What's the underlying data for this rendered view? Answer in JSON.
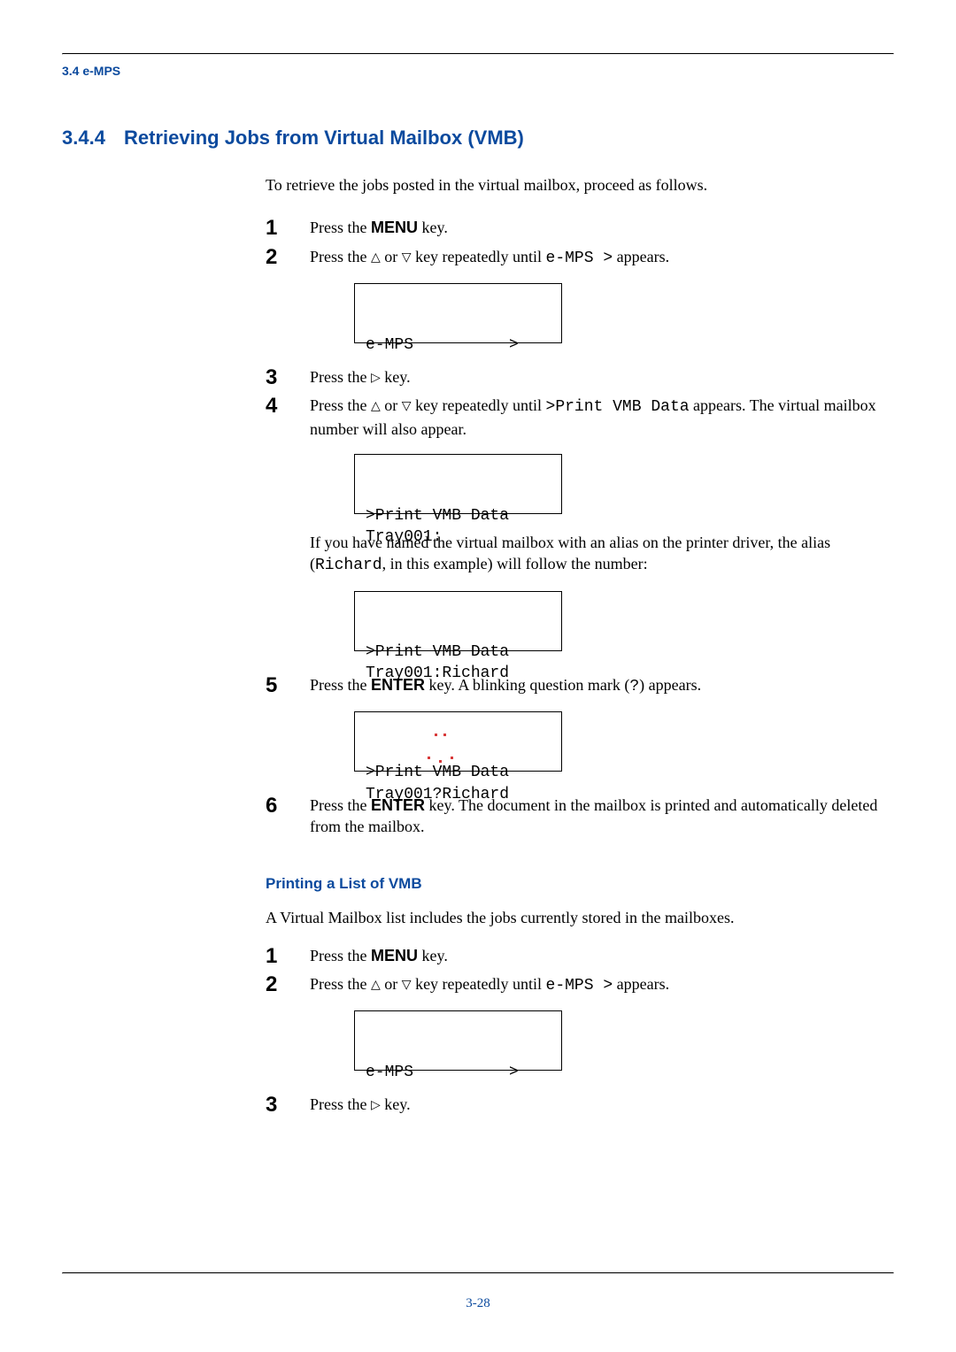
{
  "running_head": "3.4 e-MPS",
  "heading": {
    "num": "3.4.4",
    "title": "Retrieving Jobs from Virtual Mailbox (VMB)"
  },
  "intro": "To retrieve the jobs posted in the virtual mailbox, proceed as follows.",
  "glyphs": {
    "up": "△",
    "down": "▽",
    "right": "▷"
  },
  "stepsA": {
    "s1": {
      "num": "1",
      "pre": "Press the ",
      "key": "MENU",
      "post": " key."
    },
    "s2": {
      "num": "2",
      "pre": "Press the ",
      "mid": " key repeatedly until ",
      "code": "e-MPS >",
      "post": " appears."
    },
    "d2": {
      "line1": "e-MPS          >",
      "line2": ""
    },
    "s3": {
      "num": "3",
      "pre": "Press the ",
      "post": " key."
    },
    "s4": {
      "num": "4",
      "pre": "Press the ",
      "mid": " key repeatedly until ",
      "code": ">Print VMB Data",
      "post": " appears. The virtual mailbox number will also appear."
    },
    "d4": {
      "line1": ">Print VMB Data",
      "line2": "Tray001:"
    },
    "note4": {
      "pre": "If you have named the virtual mailbox with an alias on the printer driver, the alias (",
      "code": "Richard",
      "post": ", in this example) will follow the number:"
    },
    "d4b": {
      "line1": ">Print VMB Data",
      "line2": "Tray001:Richard"
    },
    "s5": {
      "num": "5",
      "pre": "Press the ",
      "key": "ENTER",
      "mid": " key. A blinking question mark (",
      "code": "?",
      "post": ") appears."
    },
    "d5": {
      "line1": ">Print VMB Data",
      "line2": "Tray001?Richard"
    },
    "s6": {
      "num": "6",
      "pre": "Press the ",
      "key": "ENTER",
      "post": " key. The document in the mailbox is printed and automatically deleted from the mailbox."
    }
  },
  "sub": {
    "title": "Printing a List of VMB",
    "intro": "A Virtual Mailbox list includes the jobs currently stored in the mailboxes.",
    "s1": {
      "num": "1",
      "pre": "Press the ",
      "key": "MENU",
      "post": " key."
    },
    "s2": {
      "num": "2",
      "pre": "Press the ",
      "mid": " key repeatedly until ",
      "code": "e-MPS >",
      "post": " appears."
    },
    "d2": {
      "line1": "e-MPS          >",
      "line2": ""
    },
    "s3": {
      "num": "3",
      "pre": "Press the ",
      "post": " key."
    }
  },
  "page_number": "3-28"
}
